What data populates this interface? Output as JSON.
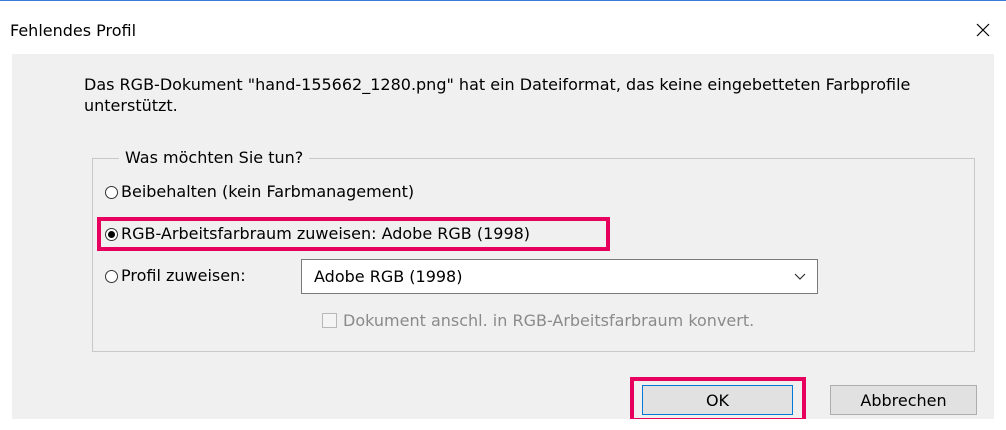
{
  "window": {
    "title": "Fehlendes Profil",
    "close_glyph": "✕"
  },
  "message": "Das RGB-Dokument \"hand-155662_1280.png\" hat ein Dateiformat, das keine eingebetteten Farbprofile unterstützt.",
  "group": {
    "legend": "Was möchten Sie tun?",
    "options": [
      {
        "label": "Beibehalten (kein Farbmanagement)",
        "checked": false
      },
      {
        "label": "RGB-Arbeitsfarbraum zuweisen: Adobe RGB (1998)",
        "checked": true
      },
      {
        "label": "Profil zuweisen:",
        "checked": false
      }
    ],
    "profile_select": {
      "value": "Adobe RGB (1998)"
    },
    "convert_checkbox": {
      "label": "Dokument anschl. in RGB-Arbeitsfarbraum konvert.",
      "checked": false,
      "disabled": true
    }
  },
  "buttons": {
    "ok": "OK",
    "cancel": "Abbrechen"
  },
  "colors": {
    "highlight": "#e8005f",
    "dialog_bg": "#f0f0f0",
    "focus_border": "#0078d7"
  }
}
